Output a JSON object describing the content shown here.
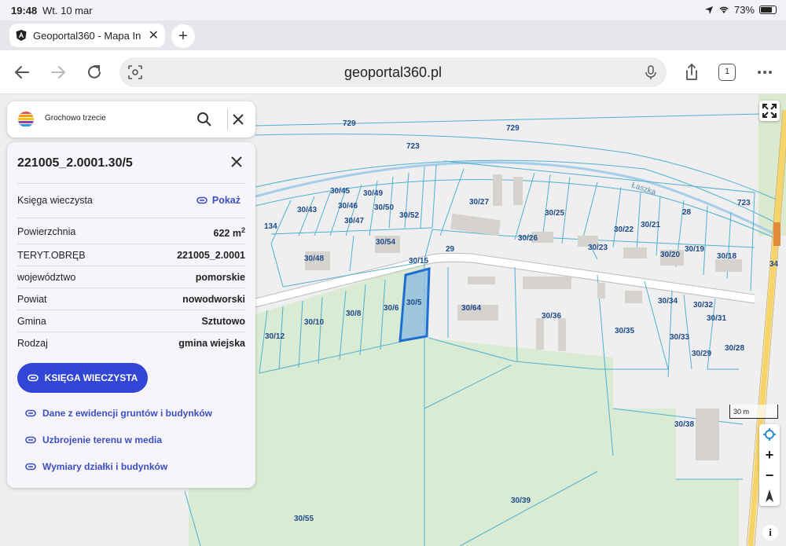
{
  "status_bar": {
    "time": "19:48",
    "date": "Wt. 10 mar",
    "battery": "73%"
  },
  "browser": {
    "tab_title": "Geoportal360 - Mapa In",
    "url": "geoportal360.pl",
    "tabs_count": "1"
  },
  "search": {
    "query": "Grochowo trzecie"
  },
  "parcel": {
    "title": "221005_2.0001.30/5",
    "kw_label": "Księga wieczysta",
    "kw_link": "Pokaż",
    "rows": [
      {
        "key": "Powierzchnia",
        "value": "622 m",
        "sup": "2"
      },
      {
        "key": "TERYT.OBRĘB",
        "value": "221005_2.0001"
      },
      {
        "key": "województwo",
        "value": "pomorskie"
      },
      {
        "key": "Powiat",
        "value": "nowodworski"
      },
      {
        "key": "Gmina",
        "value": "Sztutowo"
      },
      {
        "key": "Rodzaj",
        "value": "gmina wiejska"
      }
    ],
    "button": "KSIĘGA WIECZYSTA",
    "links": [
      "Dane z ewidencji gruntów i budynków",
      "Uzbrojenie terenu w media",
      "Wymiary działki i budynków"
    ]
  },
  "map": {
    "scale_label": "30 m",
    "parcel_labels": [
      "729",
      "729",
      "723",
      "723",
      "Łaszka",
      "28",
      "30/45",
      "30/49",
      "30/46",
      "30/43",
      "30/50",
      "30/52",
      "30/47",
      "30/27",
      "30/25",
      "134",
      "30/54",
      "30/26",
      "30/22",
      "30/21",
      "29",
      "30/48",
      "30/15",
      "30/23",
      "30/20",
      "30/19",
      "30/18",
      "34",
      "30/5",
      "30/6",
      "30/64",
      "30/34",
      "30/32",
      "30/8",
      "30/10",
      "30/36",
      "30/31",
      "30/12",
      "30/35",
      "30/33",
      "30/28",
      "30/29",
      "30/38",
      "30/39",
      "30/55"
    ],
    "colors": {
      "parcel_line": "#3aa6c8",
      "selected_fill": "#8ab7de",
      "selected_stroke": "#1f6fd0",
      "green": "#d6ecd2",
      "road": "#f5d25b"
    }
  }
}
